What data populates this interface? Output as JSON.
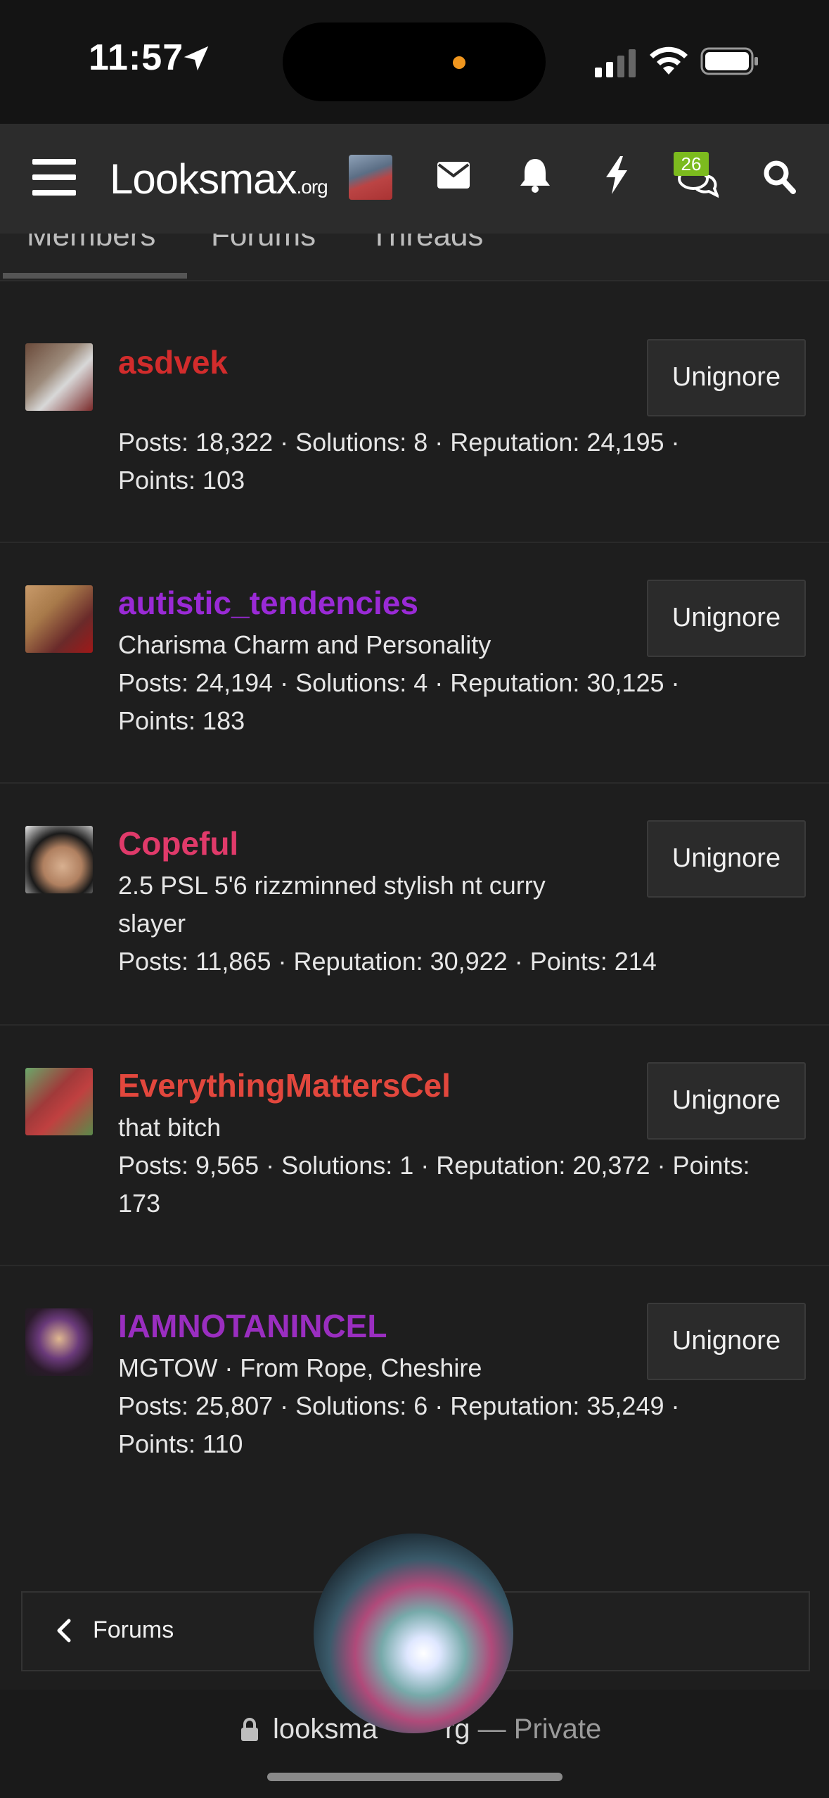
{
  "status_bar": {
    "time": "11:57"
  },
  "nav": {
    "logo_main": "Lοοksmax",
    "logo_suffix": ".org",
    "alerts_badge": "26"
  },
  "tabs": [
    {
      "label": "Members",
      "active": true
    },
    {
      "label": "Forums",
      "active": false
    },
    {
      "label": "Threads",
      "active": false
    }
  ],
  "members": [
    {
      "name": "asdvek",
      "name_color": "#d22c2c",
      "title": "",
      "stats": "Posts: 18,322 · Solutions: 8 · Reputation: 24,195 ·",
      "stats2": "Points: 103",
      "button": "Unignore"
    },
    {
      "name": "autistic_tendencies",
      "name_color": "#9a2ad6",
      "title": "Charisma Charm and Personality",
      "stats": "Posts: 24,194 · Solutions: 4 · Reputation: 30,125 ·",
      "stats2": "Points: 183",
      "button": "Unignore"
    },
    {
      "name": "Copeful",
      "name_color": "#e03a6a",
      "title": "2.5 PSL 5'6 rizzminned stylish nt curry",
      "title2": "slayer",
      "stats": "Posts: 11,865 · Reputation: 30,922 · Points: 214",
      "stats2": "",
      "button": "Unignore"
    },
    {
      "name": "EverythingMattersCel",
      "name_color": "#e2473d",
      "title": "that bitch",
      "stats": "Posts: 9,565 · Solutions: 1 · Reputation: 20,372 · Points:",
      "stats2": "173",
      "button": "Unignore"
    },
    {
      "name": "IAMNOTANINCEL",
      "name_color": "#9a2ec0",
      "title": "MGTOW · From Rope, Cheshire",
      "stats": "Posts: 25,807 · Solutions: 6 · Reputation: 35,249 ·",
      "stats2": "Points: 110",
      "button": "Unignore"
    }
  ],
  "footer": {
    "back_label": "Forums"
  },
  "url_bar": {
    "domain": "looksma",
    "domain_rest": "rg",
    "suffix": " — Private"
  }
}
